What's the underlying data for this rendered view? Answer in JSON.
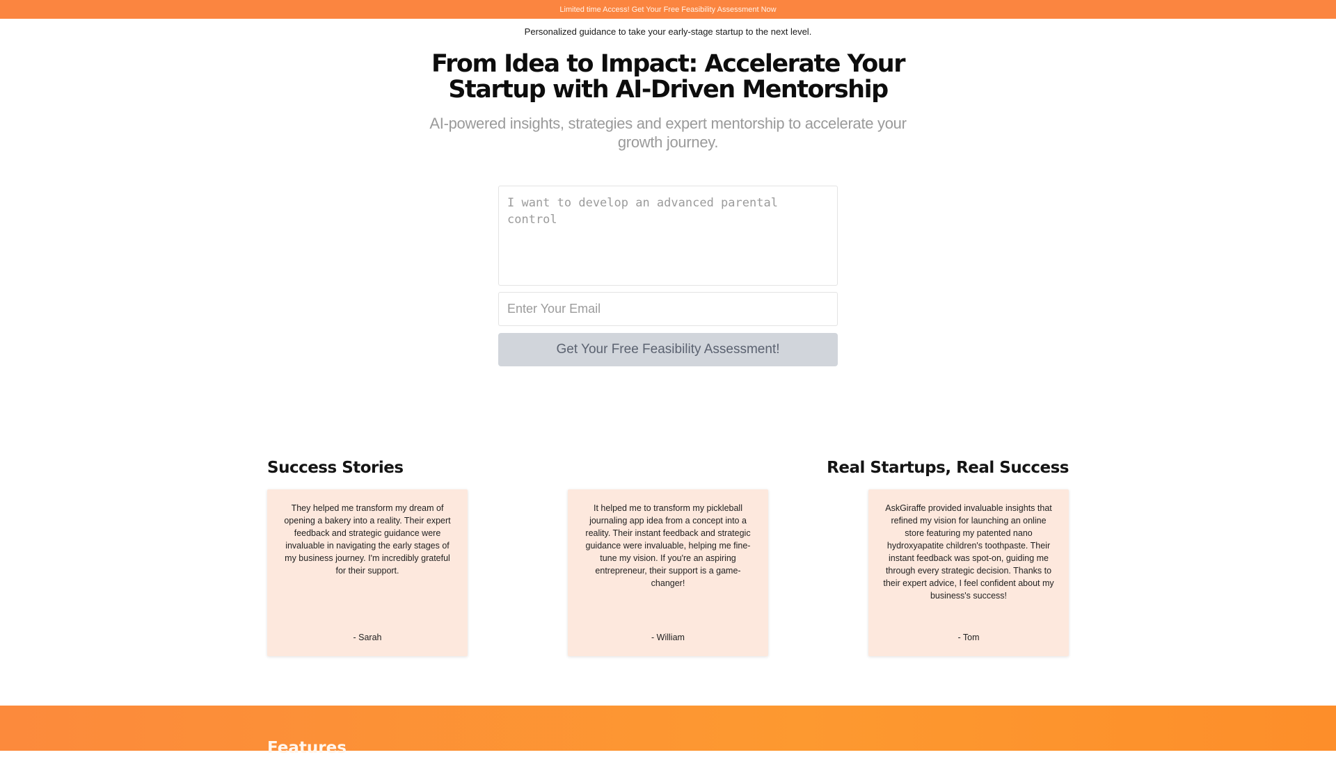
{
  "announcement": {
    "text": "Limited time Access! Get Your Free Feasibility Assessment Now"
  },
  "hero": {
    "tagline": "Personalized guidance to take your early-stage startup to the next level.",
    "title": "From Idea to Impact: Accelerate Your Startup with AI-Driven Mentorship",
    "subtitle": "AI-powered insights, strategies and expert mentorship to accelerate your growth journey."
  },
  "form": {
    "idea_placeholder": "I want to develop an advanced parental control",
    "email_placeholder": "Enter Your Email",
    "submit_label": "Get Your Free Feasibility Assessment!"
  },
  "testimonials": {
    "heading_left": "Success Stories",
    "heading_right": "Real Startups, Real Success",
    "items": [
      {
        "quote": "They helped me transform my dream of opening a bakery into a reality. Their expert feedback and strategic guidance were invaluable in navigating the early stages of my business journey. I'm incredibly grateful for their support.",
        "author": "- Sarah"
      },
      {
        "quote": "It helped me to transform my pickleball journaling app idea from a concept into a reality. Their instant feedback and strategic guidance were invaluable, helping me fine-tune my vision. If you're an aspiring entrepreneur, their support is a game-changer!",
        "author": "- William"
      },
      {
        "quote": "AskGiraffe provided invaluable insights that refined my vision for launching an online store featuring my patented nano hydroxyapatite children's toothpaste. Their instant feedback was spot-on, guiding me through every strategic decision. Thanks to their expert advice, I feel confident about my business's success!",
        "author": "- Tom"
      }
    ]
  },
  "features": {
    "heading": "Features"
  },
  "colors": {
    "accent": "#fb8540",
    "card_background": "#fde8dd",
    "button_background": "#d1d5db"
  }
}
